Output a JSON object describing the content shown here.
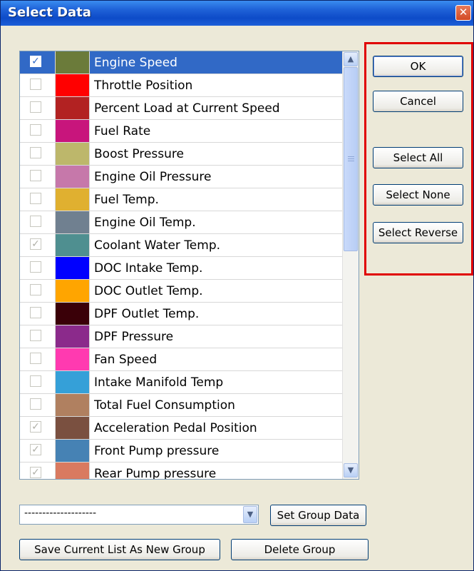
{
  "window": {
    "title": "Select Data",
    "close_glyph": "✕"
  },
  "items": [
    {
      "label": "Engine Speed",
      "color": "#6b7b3a",
      "checked": true,
      "selected": true
    },
    {
      "label": "Throttle Position",
      "color": "#ff0000",
      "checked": false
    },
    {
      "label": "Percent Load at Current Speed",
      "color": "#b22222",
      "checked": false
    },
    {
      "label": "Fuel Rate",
      "color": "#c8157c",
      "checked": false
    },
    {
      "label": "Boost Pressure",
      "color": "#bdb76b",
      "checked": false
    },
    {
      "label": "Engine Oil Pressure",
      "color": "#c678aa",
      "checked": false
    },
    {
      "label": "Fuel Temp.",
      "color": "#e0b030",
      "checked": false
    },
    {
      "label": "Engine Oil Temp.",
      "color": "#708090",
      "checked": false
    },
    {
      "label": "Coolant Water Temp.",
      "color": "#4f8f90",
      "checked": true
    },
    {
      "label": "DOC Intake Temp.",
      "color": "#0000ff",
      "checked": false
    },
    {
      "label": "DOC Outlet Temp.",
      "color": "#ffa500",
      "checked": false
    },
    {
      "label": "DPF Outlet Temp.",
      "color": "#3a0008",
      "checked": false
    },
    {
      "label": "DPF Pressure",
      "color": "#8b2a8b",
      "checked": false
    },
    {
      "label": "Fan Speed",
      "color": "#ff3ab0",
      "checked": false
    },
    {
      "label": "Intake Manifold Temp",
      "color": "#35a0d8",
      "checked": false
    },
    {
      "label": "Total Fuel Consumption",
      "color": "#b08060",
      "checked": false
    },
    {
      "label": "Acceleration Pedal Position",
      "color": "#7a5040",
      "checked": true
    },
    {
      "label": "Front Pump pressure",
      "color": "#4682b4",
      "checked": true
    },
    {
      "label": "Rear Pump pressure",
      "color": "#d97a60",
      "checked": true
    }
  ],
  "buttons": {
    "ok": "OK",
    "cancel": "Cancel",
    "select_all": "Select All",
    "select_none": "Select None",
    "select_reverse": "Select Reverse",
    "set_group": "Set Group Data",
    "save_group": "Save Current List As New Group",
    "delete_group": "Delete Group"
  },
  "group_combo": {
    "value": "--------------------"
  },
  "icons": {
    "check": "check-icon",
    "scroll_up": "scroll-up-arrow-icon",
    "scroll_down": "scroll-down-arrow-icon",
    "combo_arrow": "chevron-down-icon"
  }
}
